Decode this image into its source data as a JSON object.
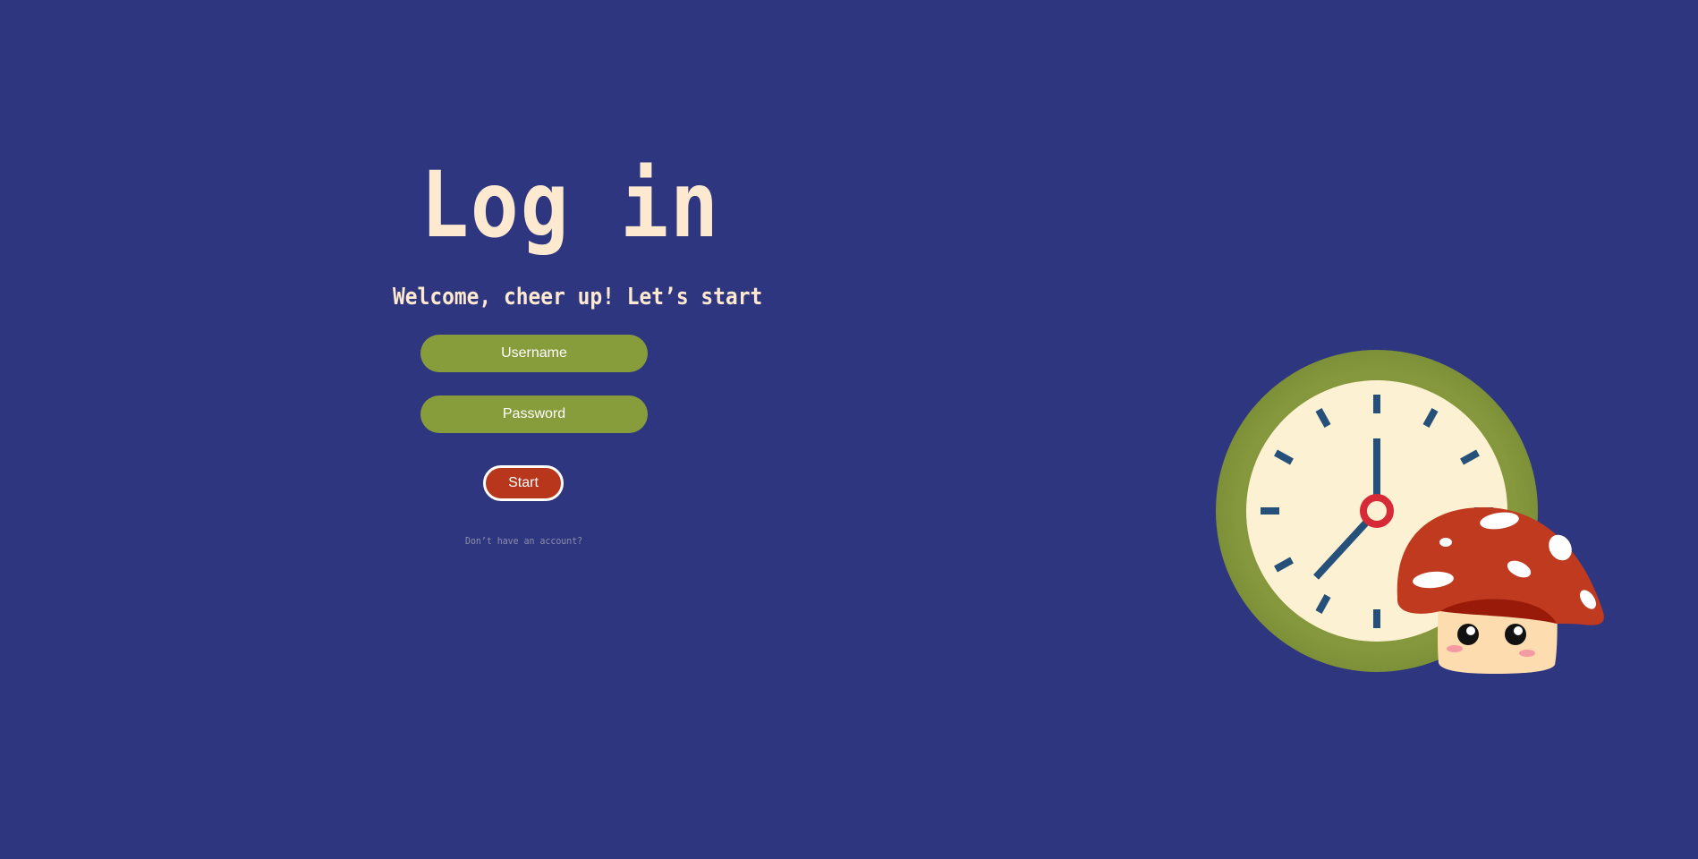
{
  "login": {
    "title": "Log in",
    "subtitle": "Welcome, cheer up! Let’s start",
    "username_placeholder": "Username",
    "password_placeholder": "Password",
    "start_label": "Start",
    "signup_link": "Don’t have an account?"
  },
  "illustration": {
    "icons": [
      "clock-icon",
      "mushroom-icon"
    ]
  },
  "colors": {
    "background": "#2f3680",
    "text_cream": "#fde9cf",
    "field_green": "#879c3b",
    "button_red": "#b7361c",
    "clock_rim": "#879c3b",
    "clock_face": "#fdf1d4",
    "clock_hands": "#245079",
    "clock_center": "#d62a36",
    "mushroom_cap": "#bf3a1f"
  }
}
